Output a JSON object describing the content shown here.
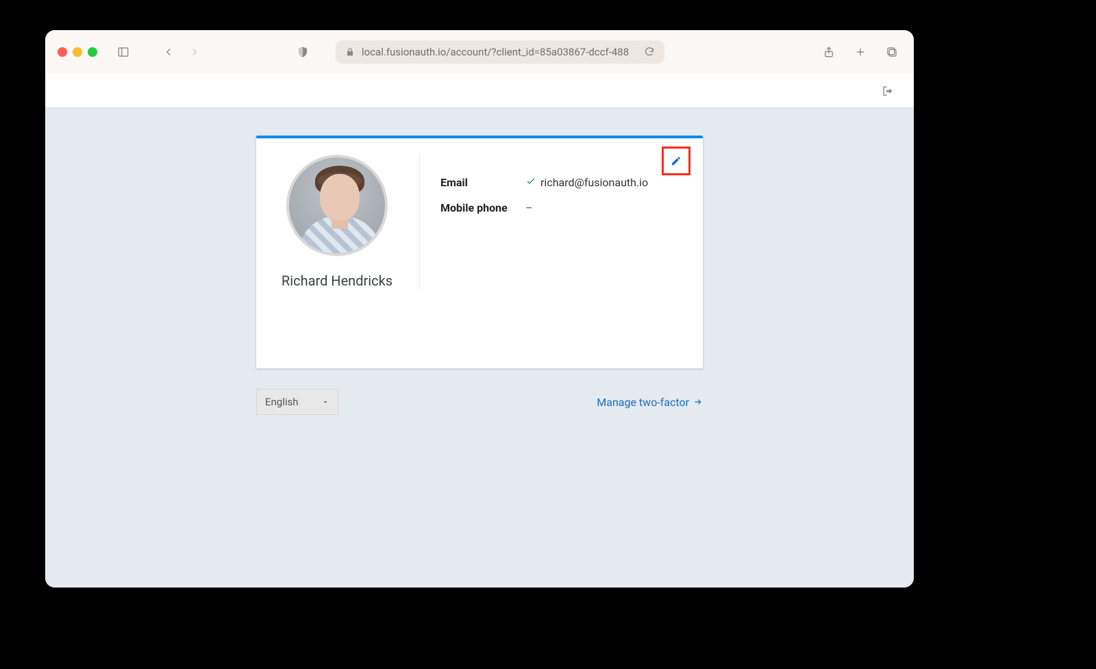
{
  "browser": {
    "url": "local.fusionauth.io/account/?client_id=85a03867-dccf-488"
  },
  "app_header": {
    "logout_icon": "logout-icon"
  },
  "account": {
    "user_name": "Richard Hendricks",
    "fields": {
      "email": {
        "label": "Email",
        "value": "richard@fusionauth.io",
        "verified": true
      },
      "mobile": {
        "label": "Mobile phone",
        "value": "–"
      }
    },
    "edit_icon": "pencil-icon"
  },
  "footer": {
    "language": "English",
    "two_factor_label": "Manage two-factor"
  },
  "colors": {
    "accent": "#0d8bf2",
    "link": "#1472c4",
    "highlight_border": "#ff2a1a"
  }
}
